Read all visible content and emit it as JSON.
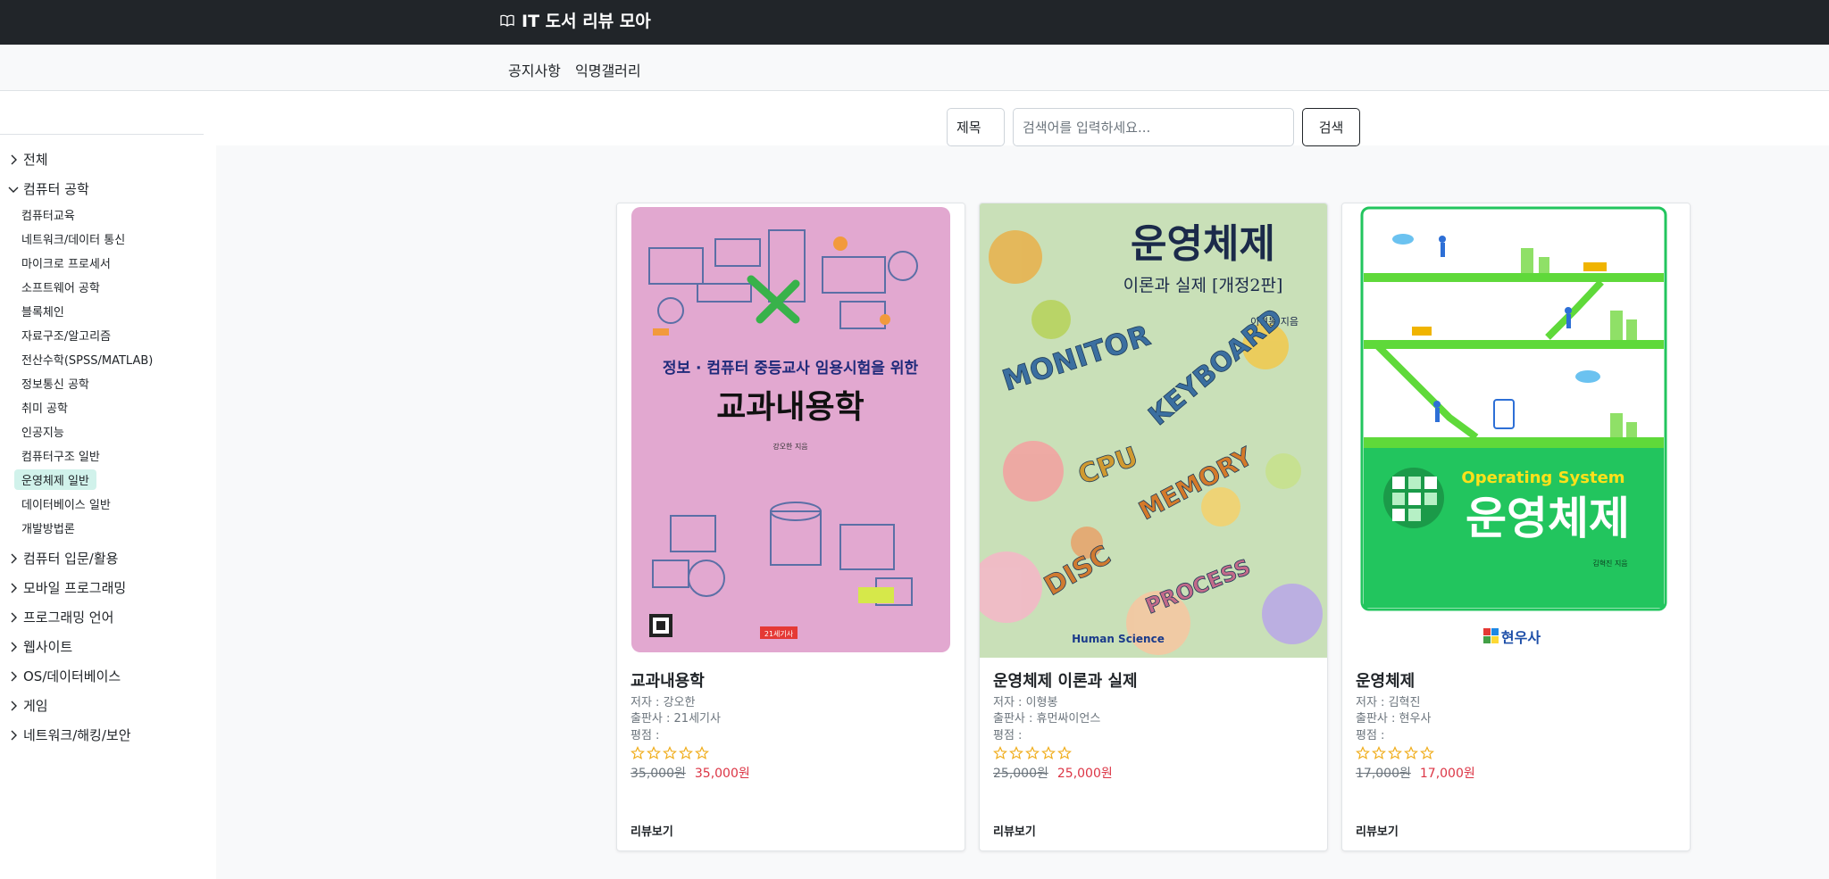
{
  "header": {
    "brand": "IT 도서 리뷰 모아",
    "brand_icon": "book-icon"
  },
  "nav": {
    "notice": "공지사항",
    "gallery": "익명갤러리"
  },
  "sidebar": {
    "categories_top": [
      {
        "label": "전체",
        "expanded": false
      },
      {
        "label": "컴퓨터 공학",
        "expanded": true
      }
    ],
    "subcategories": [
      {
        "label": "컴퓨터교육"
      },
      {
        "label": "네트워크/데이터 통신"
      },
      {
        "label": "마이크로 프로세서"
      },
      {
        "label": "소프트웨어 공학"
      },
      {
        "label": "블록체인"
      },
      {
        "label": "자료구조/알고리즘"
      },
      {
        "label": "전산수학(SPSS/MATLAB)"
      },
      {
        "label": "정보통신 공학"
      },
      {
        "label": "취미 공학"
      },
      {
        "label": "인공지능"
      },
      {
        "label": "컴퓨터구조 일반"
      },
      {
        "label": "운영체제 일반",
        "active": true
      },
      {
        "label": "데이터베이스 일반"
      },
      {
        "label": "개발방법론"
      }
    ],
    "categories_bottom": [
      {
        "label": "컴퓨터 입문/활용"
      },
      {
        "label": "모바일 프로그래밍"
      },
      {
        "label": "프로그래밍 언어"
      },
      {
        "label": "웹사이트"
      },
      {
        "label": "OS/데이터베이스"
      },
      {
        "label": "게임"
      },
      {
        "label": "네트워크/해킹/보안"
      }
    ]
  },
  "search": {
    "filter_value": "제목",
    "placeholder": "검색어를 입력하세요...",
    "button_label": "검색"
  },
  "books": [
    {
      "title": "교과내용학",
      "author": "저자 : 강오한",
      "publisher": "출판사 : 21세기사",
      "rating_label": "평점 :",
      "stars": 0,
      "original_price": "35,000원",
      "sale_price": "35,000원",
      "review_label": "리뷰보기",
      "cover": {
        "subtitle": "정보 · 컴퓨터 중등교사 임용시험을 위한",
        "title": "교과내용학",
        "author_line": "강오한 지음",
        "publisher_mark": "21세기사",
        "bg": "#e2a8d0"
      }
    },
    {
      "title": "운영체제 이론과 실제",
      "author": "저자 : 이형봉",
      "publisher": "출판사 : 휴먼싸이언스",
      "rating_label": "평점 :",
      "stars": 0,
      "original_price": "25,000원",
      "sale_price": "25,000원",
      "review_label": "리뷰보기",
      "cover": {
        "title": "운영체제",
        "subtitle": "이론과 실제 [개정2판]",
        "author_line": "이형봉 지음",
        "words": [
          "MONITOR",
          "KEYBOARD",
          "CPU",
          "MEMORY",
          "DISC",
          "PROCESS"
        ],
        "publisher_mark": "Human Science",
        "bg": "#c9e0b8"
      }
    },
    {
      "title": "운영체제",
      "author": "저자 : 김혁진",
      "publisher": "출판사 : 현우사",
      "rating_label": "평점 :",
      "stars": 0,
      "original_price": "17,000원",
      "sale_price": "17,000원",
      "review_label": "리뷰보기",
      "cover": {
        "tagline": "Operating System",
        "title": "운영체제",
        "author_line": "김혁진 지음",
        "publisher_mark": "현우사",
        "bg": "#22c55e"
      }
    }
  ]
}
